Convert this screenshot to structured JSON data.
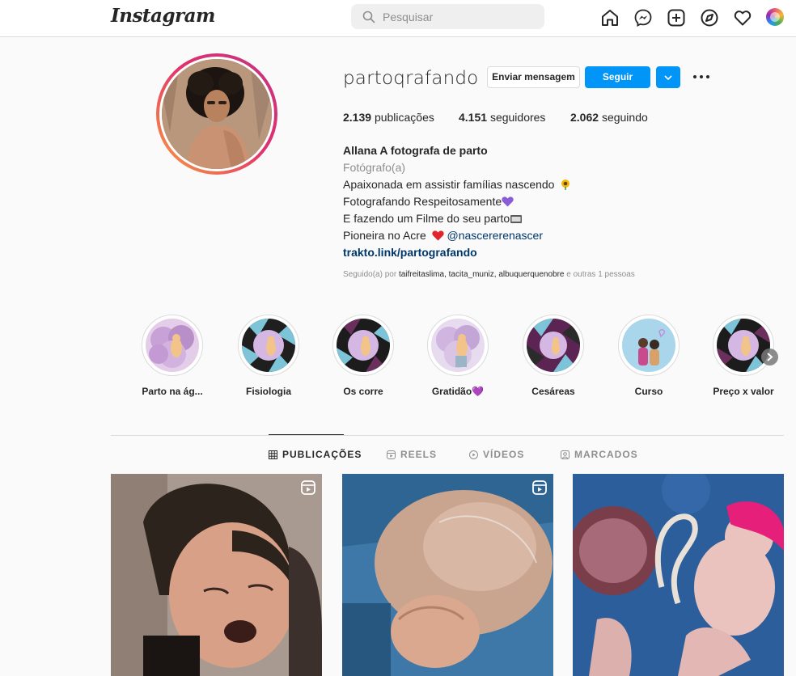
{
  "header": {
    "logo_text": "Instagram",
    "search_placeholder": "Pesquisar",
    "icons": [
      "home-icon",
      "messenger-icon",
      "new-post-icon",
      "explore-icon",
      "activity-heart-icon",
      "profile-avatar"
    ]
  },
  "profile": {
    "username": "partoqrafando",
    "buttons": {
      "message": "Enviar mensagem",
      "follow": "Seguir"
    },
    "stats": {
      "posts_value": "2.139",
      "posts_label": "publicações",
      "followers_value": "4.151",
      "followers_label": "seguidores",
      "following_value": "2.062",
      "following_label": "seguindo"
    },
    "bio": {
      "name": "Allana A fotografa de parto",
      "category": "Fotógrafo(a)",
      "line1": "Apaixonada em assistir famílias nascendo",
      "line2": "Fotografando Respeitosamente",
      "line3": "E fazendo um Filme do seu parto",
      "line4": "Pioneira no Acre",
      "mention": "@nascererenascer",
      "link": "trakto.link/partografando"
    },
    "followed_by": {
      "prefix": "Seguido(a) por",
      "accounts": "taifreitaslima, tacita_muniz, albuquerquenobre",
      "suffix": "e outras 1 pessoas"
    }
  },
  "highlights": [
    {
      "label": "Parto na ág..."
    },
    {
      "label": "Fisiologia"
    },
    {
      "label": "Os corre"
    },
    {
      "label": "Gratidão💜"
    },
    {
      "label": "Cesáreas"
    },
    {
      "label": "Curso"
    },
    {
      "label": "Preço x valor"
    }
  ],
  "tabs": [
    {
      "label": "PUBLICAÇÕES",
      "active": true
    },
    {
      "label": "REELS",
      "active": false
    },
    {
      "label": "VÍDEOS",
      "active": false
    },
    {
      "label": "MARCADOS",
      "active": false
    }
  ],
  "colors": {
    "accent": "#0095f6",
    "text": "#262626",
    "muted": "#8e8e8e",
    "link": "#00376b",
    "border": "#dbdbdb"
  }
}
